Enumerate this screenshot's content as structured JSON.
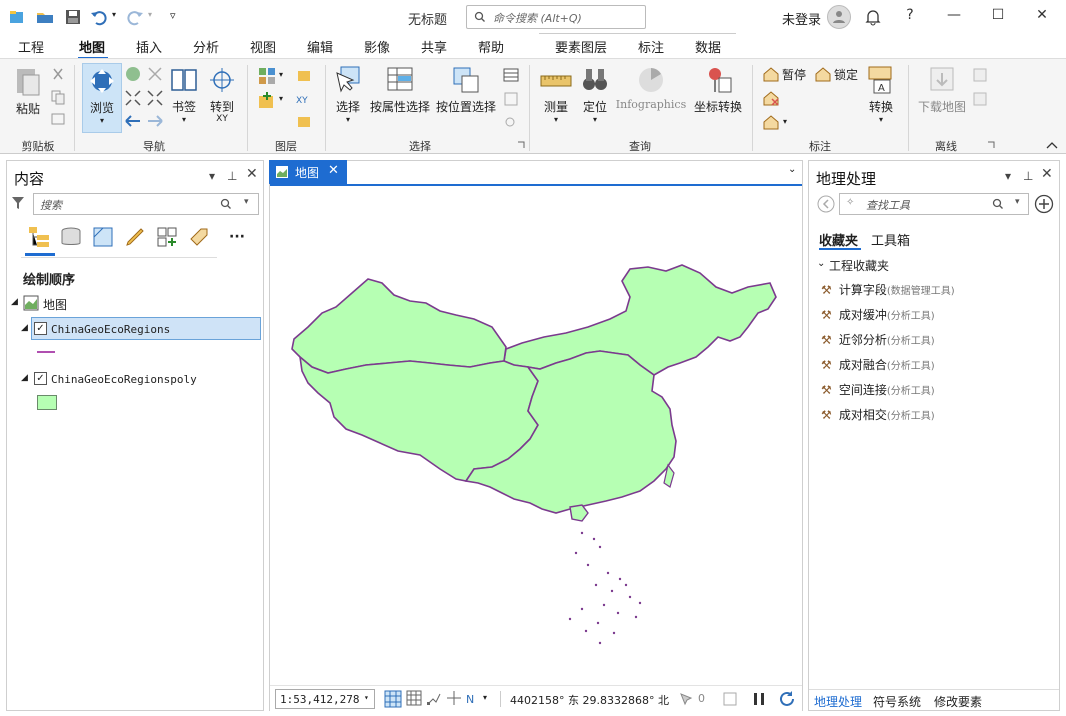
{
  "window": {
    "title": "无标题",
    "command_search_placeholder": "命令搜索 (Alt+Q)",
    "login": "未登录",
    "help": "?"
  },
  "tabs": [
    {
      "label": "工程"
    },
    {
      "label": "地图"
    },
    {
      "label": "插入"
    },
    {
      "label": "分析"
    },
    {
      "label": "视图"
    },
    {
      "label": "编辑"
    },
    {
      "label": "影像"
    },
    {
      "label": "共享"
    },
    {
      "label": "帮助"
    },
    {
      "label": "要素图层"
    },
    {
      "label": "标注"
    },
    {
      "label": "数据"
    }
  ],
  "ribbon": {
    "paste": "粘贴",
    "browse": "浏览",
    "bookmark": "书签",
    "goto": "转到",
    "goto_sub": "XY",
    "select": "选择",
    "select_by_attr": "按属性选择",
    "select_by_loc": "按位置选择",
    "measure": "测量",
    "locate": "定位",
    "infographics": "Infographics",
    "coord_convert": "坐标转换",
    "pause": "暂停",
    "lock": "锁定",
    "convert": "转换",
    "download_map": "下载地图",
    "groups": {
      "clipboard": "剪贴板",
      "navigate": "导航",
      "layer": "图层",
      "selection": "选择",
      "inquiry": "查询",
      "labeling": "标注",
      "offline": "离线"
    }
  },
  "contents": {
    "title": "内容",
    "search_placeholder": "搜索",
    "draw_order": "绘制顺序",
    "map_name": "地图",
    "layers": [
      {
        "name": "ChinaGeoEcoRegions",
        "checked": true,
        "selected": true,
        "symbol": "line",
        "color": "#b04fb0"
      },
      {
        "name": "ChinaGeoEcoRegionspoly",
        "checked": true,
        "selected": false,
        "symbol": "fill",
        "color": "#b6ffb3"
      }
    ]
  },
  "map": {
    "tab_label": "地图",
    "fill_color": "#b6ffb3",
    "stroke_color": "#7b3a8e",
    "scale": "1:53,412,278",
    "coordinates": "4402158° 东 29.8332868° 北",
    "selected_count": "0"
  },
  "geoprocessing": {
    "title": "地理处理",
    "search_placeholder": "查找工具",
    "tab_favorites": "收藏夹",
    "tab_toolboxes": "工具箱",
    "section": "工程收藏夹",
    "tools": [
      {
        "name": "计算字段",
        "toolbox": "(数据管理工具)"
      },
      {
        "name": "成对缓冲",
        "toolbox": "(分析工具)"
      },
      {
        "name": "近邻分析",
        "toolbox": "(分析工具)"
      },
      {
        "name": "成对融合",
        "toolbox": "(分析工具)"
      },
      {
        "name": "空间连接",
        "toolbox": "(分析工具)"
      },
      {
        "name": "成对相交",
        "toolbox": "(分析工具)"
      }
    ],
    "bottom_tabs": [
      {
        "label": "地理处理"
      },
      {
        "label": "符号系统"
      },
      {
        "label": "修改要素"
      }
    ]
  },
  "colors": {
    "accent": "#1e6cd1",
    "selected_row": "#cfe3f7"
  }
}
